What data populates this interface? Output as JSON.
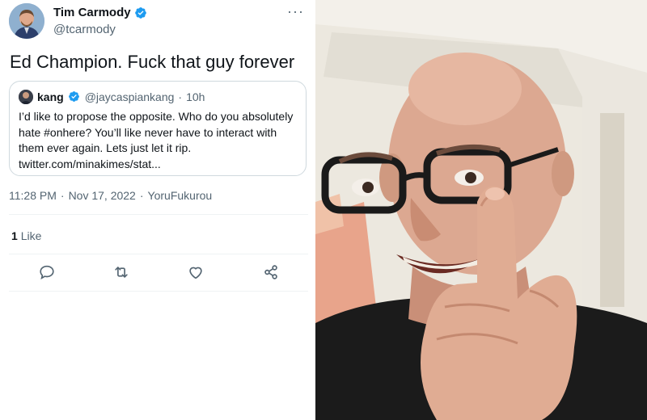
{
  "tweet": {
    "author": {
      "display_name": "Tim Carmody",
      "handle": "@tcarmody",
      "avatar_icon": "avatar-photo",
      "verified_icon": "verified-badge-icon"
    },
    "more_icon": "more-icon",
    "more_label": "···",
    "text": "Ed Champion. Fuck that guy forever",
    "quoted_tweet": {
      "display_name": "kang",
      "handle": "@jaycaspiankang",
      "separator": "·",
      "time": "10h",
      "lines": [
        "I’d like to propose the opposite. Who do you absolutely",
        "hate #onhere? You’ll like never have to interact with",
        "them ever again. Lets just let it rip.",
        "twitter.com/minakimes/stat..."
      ]
    },
    "meta": {
      "time": "11:28 PM",
      "sep1": "·",
      "date": "Nov 17, 2022",
      "sep2": "·",
      "source": "YoruFukurou"
    },
    "likes": {
      "count": "1",
      "label": "Like"
    },
    "actions": {
      "reply_icon": "reply-icon",
      "retweet_icon": "retweet-icon",
      "like_icon": "heart-icon",
      "share_icon": "share-icon"
    }
  },
  "photo": {
    "description_icon": "photo-middle-finger",
    "colors": {
      "wall": "#e7e2d8",
      "skin": "#d8a48b",
      "shirt": "#1a1a1a",
      "curtain": "#e9a48a"
    }
  },
  "colors": {
    "text_primary": "#0f1419",
    "text_secondary": "#536471",
    "border": "#cfd9de",
    "verified": "#1d9bf0"
  }
}
